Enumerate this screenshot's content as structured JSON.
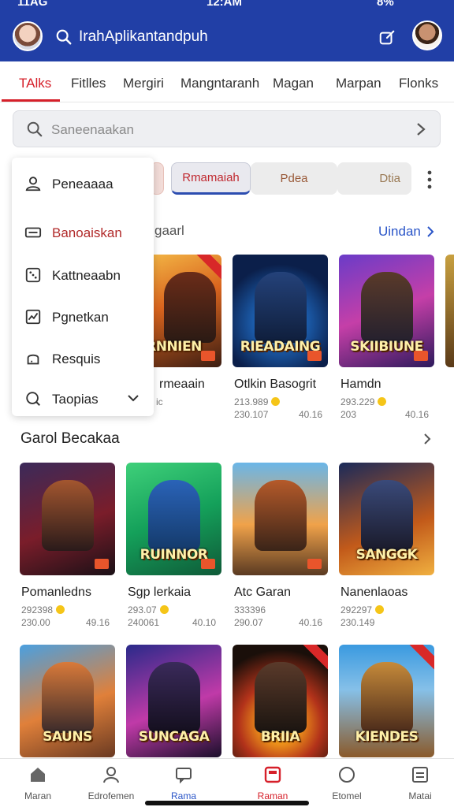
{
  "status_bar": {
    "time_left": "11AG",
    "time_center": "12:AM",
    "indicators": "8%"
  },
  "header": {
    "title": "IrahAplikantandpuh"
  },
  "tabs": [
    {
      "label": "TAlks",
      "active": true
    },
    {
      "label": "Fitlles",
      "active": false
    },
    {
      "label": "Mergiri",
      "active": false
    },
    {
      "label": "Mangntaranh",
      "active": false
    },
    {
      "label": "Magan",
      "active": false
    },
    {
      "label": "Marpan",
      "active": false
    },
    {
      "label": "Flonks",
      "active": false
    }
  ],
  "search": {
    "placeholder": "Saneenaakan"
  },
  "filters": {
    "chip2": "Rmamaiah",
    "chip3": "Pdea",
    "chip4": "Dtia"
  },
  "menu": {
    "items": [
      {
        "label": "Peneaaaa",
        "icon": "user-icon"
      },
      {
        "label": "Banoaiskan",
        "icon": "card-icon",
        "selected": true
      },
      {
        "label": "Kattneaabn",
        "icon": "dice-icon"
      },
      {
        "label": "Pgnetkan",
        "icon": "image-icon"
      },
      {
        "label": "Resquis",
        "icon": "bell-icon"
      },
      {
        "label": "Taopias",
        "icon": "search-icon"
      }
    ]
  },
  "section1": {
    "title_partial": "gaarl",
    "link": "Uindan"
  },
  "section2": {
    "title": "Garol Becakaa"
  },
  "row1": [
    {
      "art_title": "RNNIEN",
      "name": "rmeaain",
      "meta1": "",
      "meta2": "ic",
      "meta3": ""
    },
    {
      "art_title": "RIEADAING",
      "name": "Otlkin Basogrit",
      "meta1": "213.989",
      "meta2": "230.107",
      "meta3": "40.16"
    },
    {
      "art_title": "SKIIBIUNE",
      "name": "Hamdn",
      "meta1": "293.229",
      "meta2": "203",
      "meta3": "40.16"
    }
  ],
  "row2": [
    {
      "art_title": "",
      "name": "Pomanledns",
      "meta1": "292398",
      "meta2": "230.00",
      "meta3": "49.16"
    },
    {
      "art_title": "RUINNOR",
      "name": "Sgp lerkaia",
      "meta1": "293.07",
      "meta2": "240061",
      "meta3": "40.10"
    },
    {
      "art_title": "",
      "name": "Atc Garan",
      "meta1": "333396",
      "meta2": "290.07",
      "meta3": "40.16"
    },
    {
      "art_title": "SANGGK",
      "name": "Nanenlaoas",
      "meta1": "292297",
      "meta2": "230.149",
      "meta3": ""
    }
  ],
  "row3": [
    {
      "art_title": "SAUNS"
    },
    {
      "art_title": "SUNCAGA"
    },
    {
      "art_title": "BRIIA"
    },
    {
      "art_title": "KIENDES"
    }
  ],
  "bottom_nav": [
    {
      "label": "Maran",
      "icon": "home-icon"
    },
    {
      "label": "Edrofemen",
      "icon": "profile-icon"
    },
    {
      "label": "Rama",
      "icon": "chat-icon"
    },
    {
      "label": "Raman",
      "icon": "store-icon"
    },
    {
      "label": "Etomel",
      "icon": "circle-icon"
    },
    {
      "label": "Matai",
      "icon": "list-icon"
    }
  ],
  "colors": {
    "header": "#213fa6",
    "accent_red": "#d6202a",
    "link_blue": "#2a55c8"
  }
}
